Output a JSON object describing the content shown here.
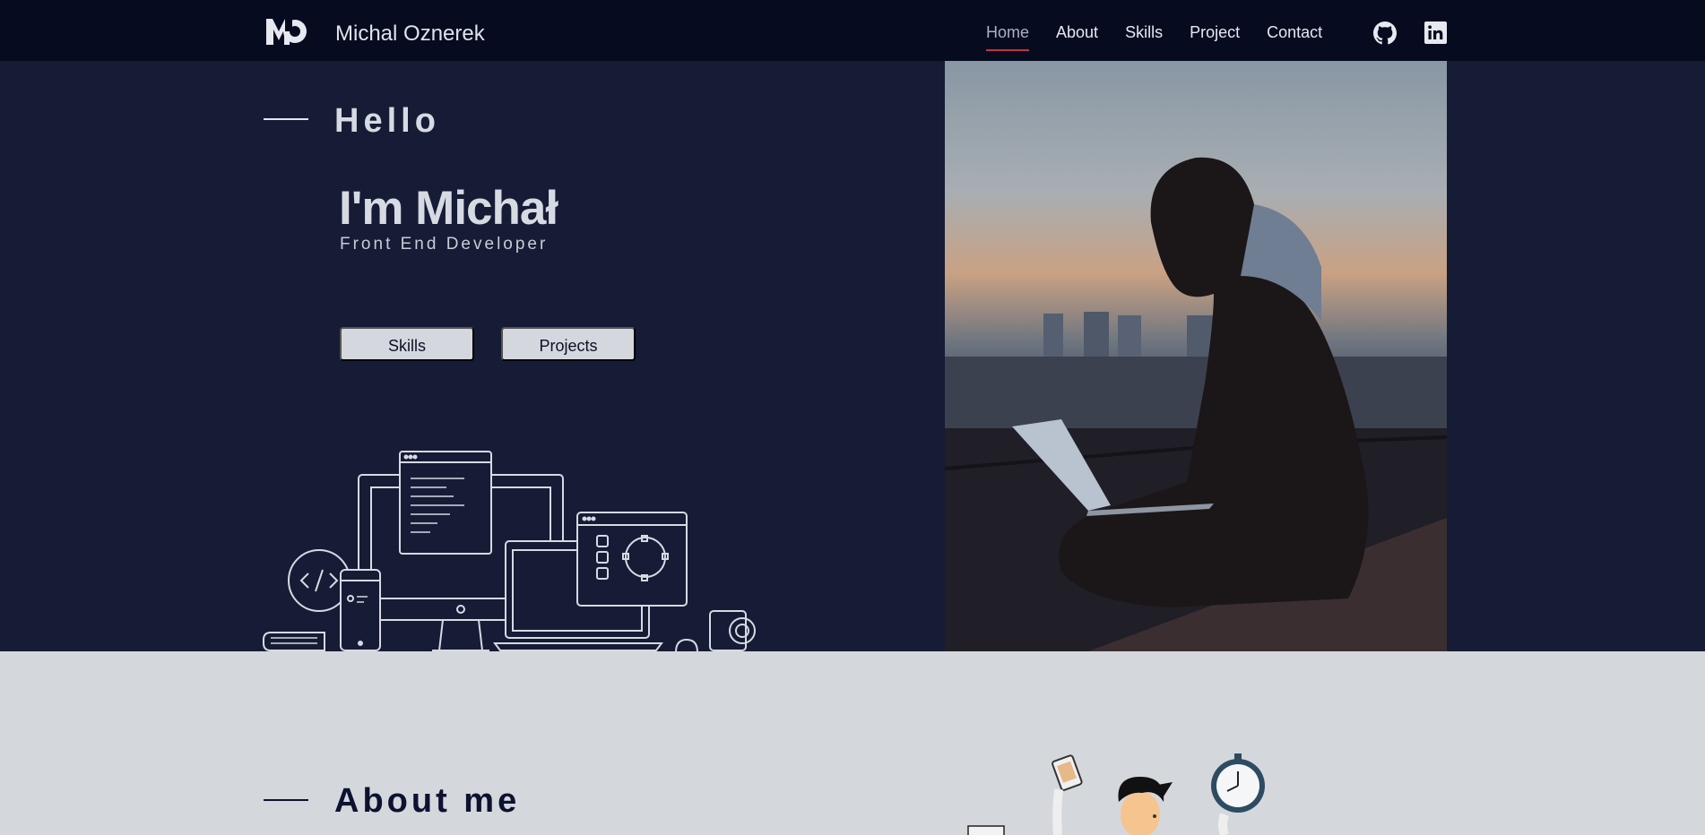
{
  "nav": {
    "brand": "Michal Oznerek",
    "links": [
      "Home",
      "About",
      "Skills",
      "Project",
      "Contact"
    ],
    "active": "Home",
    "icons": [
      "mo-logo-icon",
      "github-icon",
      "linkedin-icon"
    ]
  },
  "hero": {
    "greeting": "Hello",
    "name": "I'm Michał",
    "role": "Front End Developer",
    "buttons": {
      "skills": "Skills",
      "projects": "Projects"
    }
  },
  "about": {
    "title": "About me"
  },
  "colors": {
    "nav_bg": "#060b20",
    "hero_bg": "#161c36",
    "about_bg": "#d4d7dc",
    "active_underline": "#c0333f"
  }
}
